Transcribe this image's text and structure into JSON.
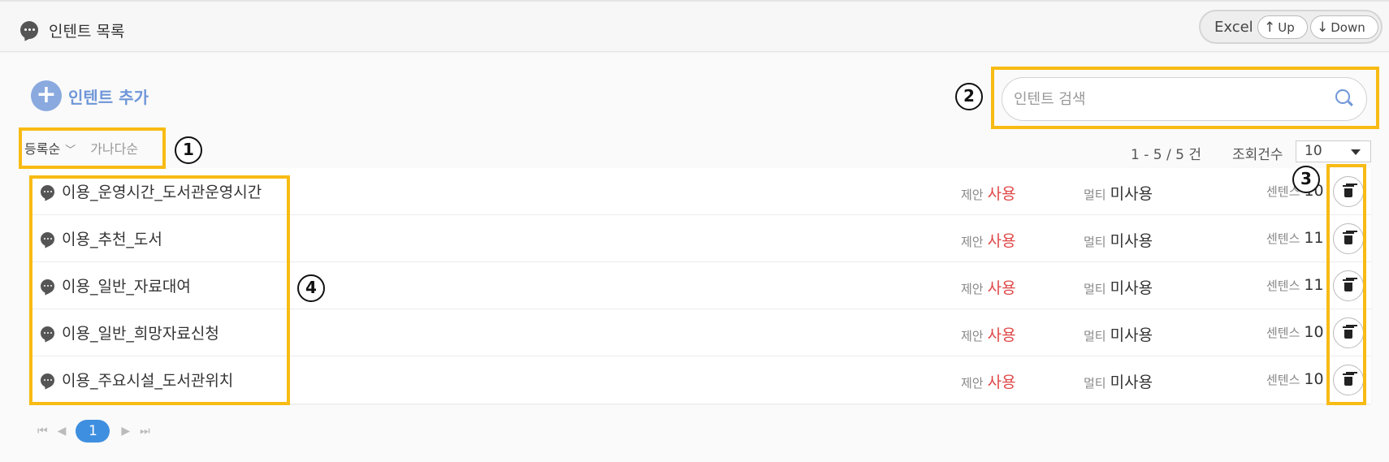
{
  "header": {
    "title": "인텐트 목록",
    "excel_label": "Excel",
    "up_label": "Up",
    "down_label": "Down",
    "up_arrow": "↑",
    "down_arrow": "↓"
  },
  "toolbar": {
    "add_label": "인텐트 추가",
    "add_symbol": "+",
    "search_placeholder": "인텐트 검색"
  },
  "sort": {
    "active": "등록순",
    "inactive": "가나다순",
    "chevron": "﹀"
  },
  "summary": {
    "count_text": "1 - 5 / 5 건",
    "rows_label": "조회건수",
    "rows_value": "10"
  },
  "labels": {
    "suggest": "제안",
    "multi": "멀티",
    "sentence": "센텐스"
  },
  "intents": [
    {
      "name": "이용_운영시간_도서관운영시간",
      "suggest": "사용",
      "multi": "미사용",
      "sentences": "10"
    },
    {
      "name": "이용_추천_도서",
      "suggest": "사용",
      "multi": "미사용",
      "sentences": "11"
    },
    {
      "name": "이용_일반_자료대여",
      "suggest": "사용",
      "multi": "미사용",
      "sentences": "11"
    },
    {
      "name": "이용_일반_희망자료신청",
      "suggest": "사용",
      "multi": "미사용",
      "sentences": "10"
    },
    {
      "name": "이용_주요시설_도서관위치",
      "suggest": "사용",
      "multi": "미사용",
      "sentences": "10"
    }
  ],
  "pagination": {
    "first": "⏮",
    "prev": "◀",
    "current": "1",
    "next": "▶",
    "last": "⏭"
  },
  "annotations": {
    "n1": "1",
    "n2": "2",
    "n3": "3",
    "n4": "4",
    "color": "#f8bb14"
  },
  "colors": {
    "accent": "#6f96d8",
    "active_page": "#3f8fe0",
    "used_red": "#e04848"
  }
}
